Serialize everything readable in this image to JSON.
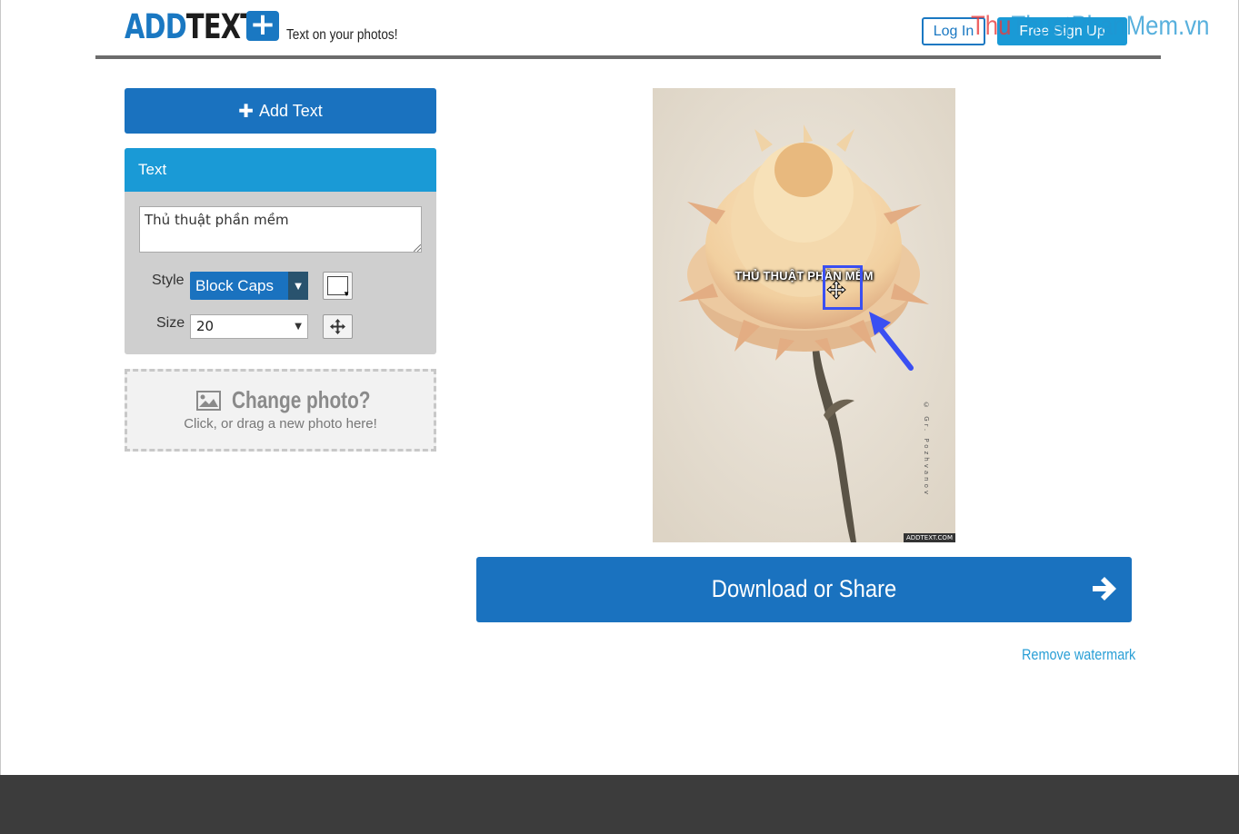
{
  "header": {
    "logo_add": "ADD",
    "logo_text": "TEXT",
    "logo_plus": "+",
    "tagline": "Text on your photos!",
    "login_label": "Log In",
    "signup_label": "Free Sign Up",
    "watermark_part1": "Thu",
    "watermark_part2": "ThuatPhanMem.vn"
  },
  "sidebar": {
    "add_text_label": "Add Text",
    "panel_title": "Text",
    "text_value": "Thủ thuật phần mềm",
    "style_label": "Style",
    "style_value": "Block Caps",
    "size_label": "Size",
    "size_value": "20",
    "text_color": "#ffffff",
    "change_photo_title": "Change photo?",
    "change_photo_sub": "Click, or drag a new photo here!"
  },
  "photo": {
    "overlay_text": "THỦ THUẬT PHẦN MỀM",
    "credit": "© Gr. Pozhvanov",
    "brand": "ADDTEXT.COM"
  },
  "main": {
    "download_label": "Download or Share",
    "remove_watermark_label": "Remove watermark"
  },
  "colors": {
    "primary_blue": "#1a72bf",
    "light_blue": "#1a9ad6",
    "annotation_blue": "#3a4ff2"
  },
  "icons": {
    "plus": "plus-icon",
    "dropdown": "chevron-down-icon",
    "move": "move-icon",
    "picture": "picture-icon",
    "download_arrow": "arrow-right-icon",
    "drag_cursor": "move-cursor-icon"
  }
}
